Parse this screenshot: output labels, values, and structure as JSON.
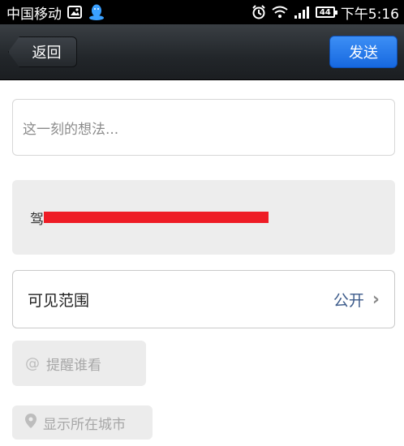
{
  "status_bar": {
    "carrier": "中国移动",
    "battery": "44",
    "time": "下午5:16",
    "icons": [
      "image-icon",
      "qq-icon",
      "alarm-icon",
      "wifi-icon",
      "signal-icon",
      "battery-icon"
    ]
  },
  "nav": {
    "back_label": "返回",
    "send_label": "发送",
    "send_color": "#1e74eb"
  },
  "compose": {
    "placeholder": "这一刻的想法..."
  },
  "location": {
    "text": "驾",
    "redaction_color": "#ee1c25"
  },
  "visibility": {
    "label": "可见范围",
    "value": "公开"
  },
  "mention": {
    "label": "提醒谁看",
    "icon": "at-icon"
  },
  "city": {
    "label": "显示所在城市",
    "icon": "location-pin-icon"
  }
}
